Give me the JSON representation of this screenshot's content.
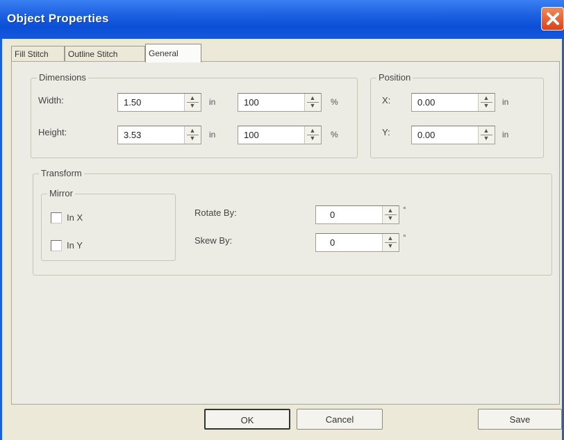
{
  "window": {
    "title": "Object Properties"
  },
  "tabs": [
    {
      "label": "Fill Stitch"
    },
    {
      "label": "Outline Stitch"
    },
    {
      "label": "General"
    }
  ],
  "dimensions": {
    "legend": "Dimensions",
    "width_label": "Width:",
    "width_value": "1.50",
    "width_unit": "in",
    "width_percent": "100",
    "width_percent_unit": "%",
    "height_label": "Height:",
    "height_value": "3.53",
    "height_unit": "in",
    "height_percent": "100",
    "height_percent_unit": "%"
  },
  "position": {
    "legend": "Position",
    "x_label": "X:",
    "x_value": "0.00",
    "x_unit": "in",
    "y_label": "Y:",
    "y_value": "0.00",
    "y_unit": "in"
  },
  "transform": {
    "legend": "Transform",
    "mirror_legend": "Mirror",
    "in_x_label": "In X",
    "in_y_label": "In Y",
    "rotate_label": "Rotate By:",
    "rotate_value": "0",
    "rotate_unit": "°",
    "skew_label": "Skew By:",
    "skew_value": "0",
    "skew_unit": "°"
  },
  "buttons": {
    "ok": "OK",
    "cancel": "Cancel",
    "save": "Save"
  },
  "colors": {
    "titlebar": "#1c5fe0",
    "close": "#d9431b",
    "dialog_bg": "#ece9d8"
  }
}
